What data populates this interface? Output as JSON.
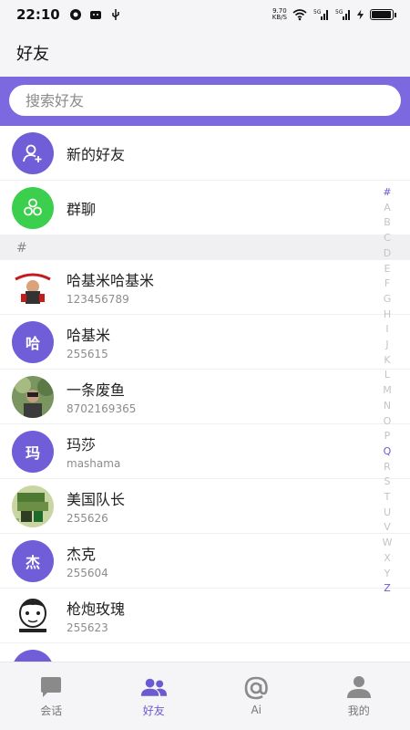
{
  "status_bar": {
    "time": "22:10",
    "net_speed_value": "9.70",
    "net_speed_unit": "KB/S",
    "signal_1": "5G",
    "signal_2": "5G"
  },
  "header": {
    "title": "好友"
  },
  "search": {
    "placeholder": "搜索好友"
  },
  "actions": [
    {
      "label": "新的好友",
      "icon": "add-user-icon",
      "color": "#6f5ed8"
    },
    {
      "label": "群聊",
      "icon": "group-chat-icon",
      "color": "#3ccf4e"
    }
  ],
  "section": {
    "label": "#"
  },
  "contacts": [
    {
      "name": "哈基米哈基米",
      "id": "123456789",
      "avatar_type": "image"
    },
    {
      "name": "哈基米",
      "id": "255615",
      "avatar_type": "letter",
      "avatar_text": "哈",
      "color": "#6f5ed8"
    },
    {
      "name": "一条废鱼",
      "id": "8702169365",
      "avatar_type": "image"
    },
    {
      "name": "玛莎",
      "id": "mashama",
      "avatar_type": "letter",
      "avatar_text": "玛",
      "color": "#6f5ed8"
    },
    {
      "name": "美国队长",
      "id": "255626",
      "avatar_type": "image"
    },
    {
      "name": "杰克",
      "id": "255604",
      "avatar_type": "letter",
      "avatar_text": "杰",
      "color": "#6f5ed8"
    },
    {
      "name": "枪炮玫瑰",
      "id": "255623",
      "avatar_type": "image"
    }
  ],
  "index_letters": [
    "#",
    "A",
    "B",
    "C",
    "D",
    "E",
    "F",
    "G",
    "H",
    "I",
    "J",
    "K",
    "L",
    "M",
    "N",
    "O",
    "P",
    "Q",
    "R",
    "S",
    "T",
    "U",
    "V",
    "W",
    "X",
    "Y",
    "Z"
  ],
  "index_active": [
    "#",
    "Q",
    "Z"
  ],
  "bottom_nav": [
    {
      "label": "会话",
      "icon": "chat-bubble-icon",
      "active": false
    },
    {
      "label": "好友",
      "icon": "friends-icon",
      "active": true
    },
    {
      "label": "Ai",
      "icon": "at-sign-icon",
      "active": false
    },
    {
      "label": "我的",
      "icon": "profile-icon",
      "active": false
    }
  ],
  "colors": {
    "accent": "#6b5bd1",
    "search_band": "#7c69df",
    "green": "#3ccf4e",
    "inactive": "#8a8a8a"
  }
}
